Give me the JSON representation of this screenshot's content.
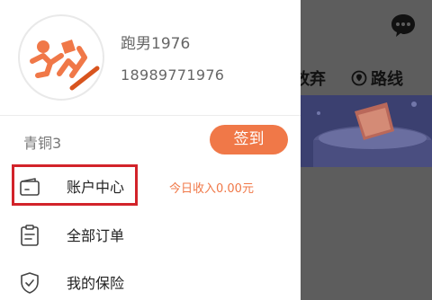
{
  "profile": {
    "username": "跑男1976",
    "phone": "18989771976",
    "level": "青铜3",
    "signin_label": "签到"
  },
  "menu": {
    "account_center": "账户中心",
    "today_income": "今日收入0.00元",
    "all_orders": "全部订单",
    "my_insurance": "我的保险"
  },
  "background": {
    "tab_giveup": "放弃",
    "tab_route": "路线"
  },
  "colors": {
    "accent": "#f07848",
    "highlight_border": "#d2232a"
  }
}
